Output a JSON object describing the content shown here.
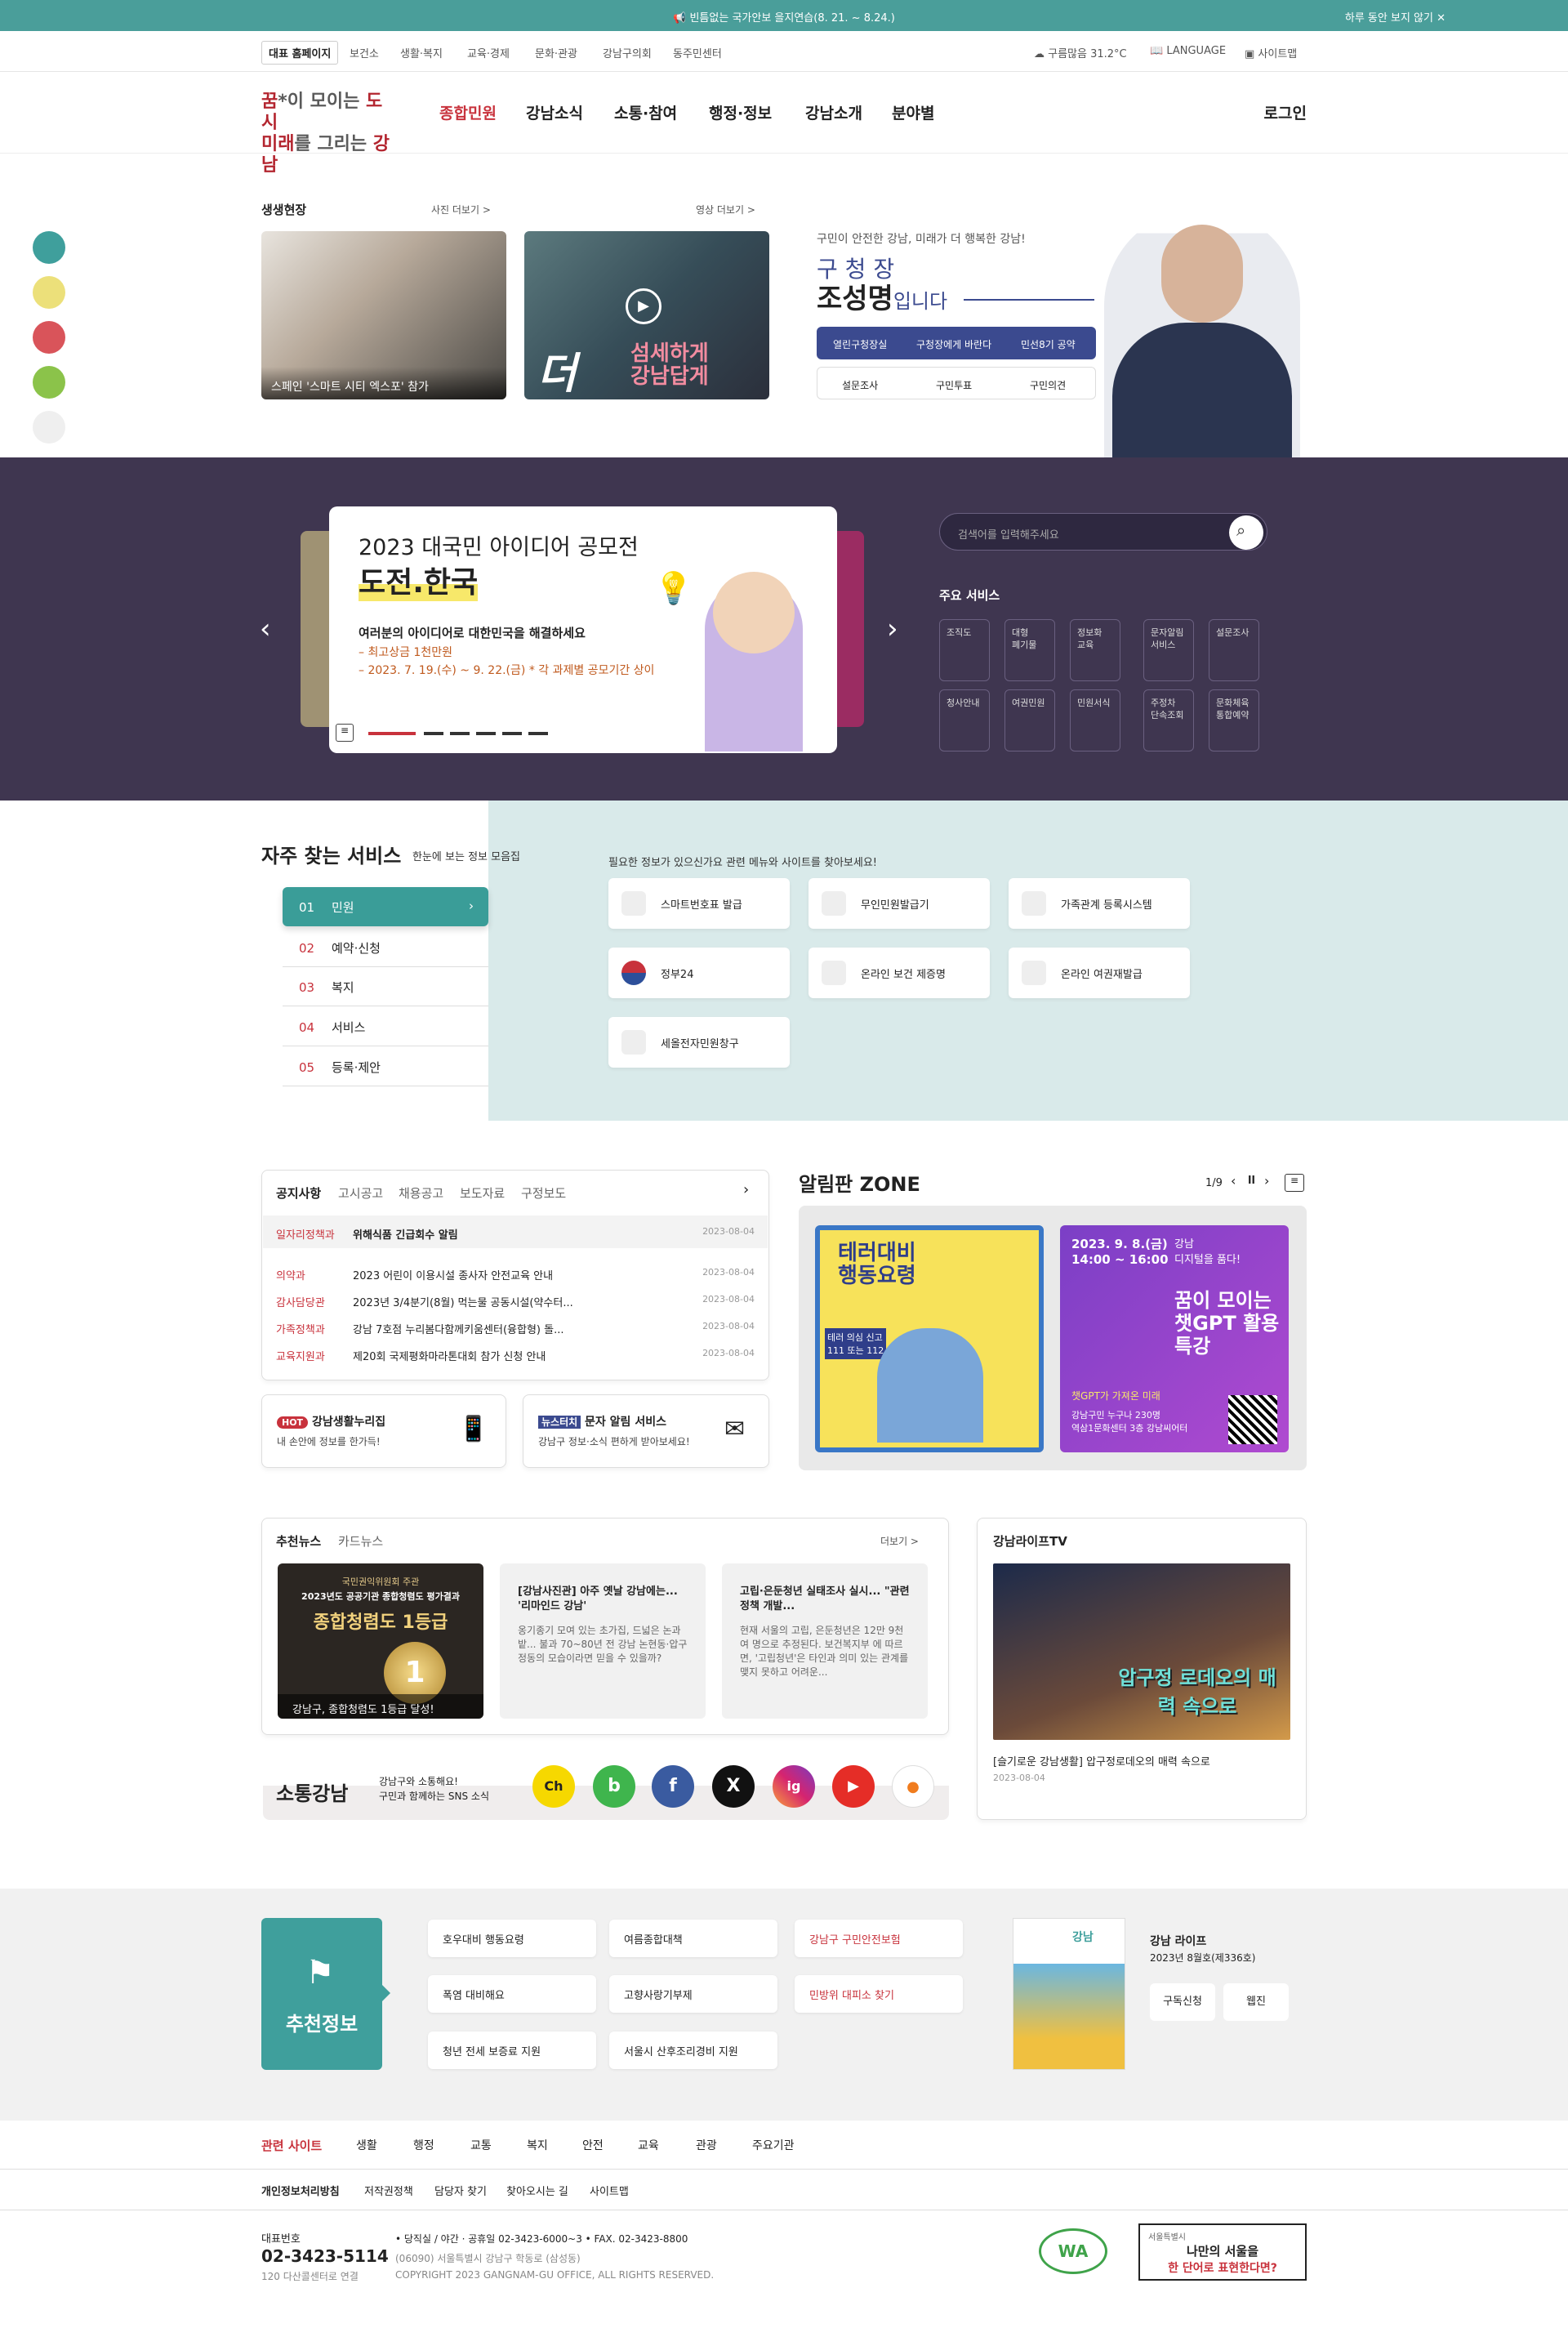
{
  "topbar": {
    "notice": "빈틈없는 국가안보 을지연습(8. 21. ~ 8.24.)",
    "close": "하루 동안 보지 않기"
  },
  "subnav": {
    "home": "대표 홈페이지",
    "links": [
      "보건소",
      "생활·복지",
      "교육·경제",
      "문화·관광",
      "강남구의회",
      "동주민센터"
    ],
    "weather": "구름많음  31.2°C",
    "language": "LANGUAGE",
    "sitemap": "사이트맵"
  },
  "gnb": {
    "logo_line1a": "꿈",
    "logo_line1b": "*이 모이는 ",
    "logo_line1c": "도시",
    "logo_line2a": "미래",
    "logo_line2b": "를 그리는 ",
    "logo_line2c": "강남",
    "menu": [
      "종합민원",
      "강남소식",
      "소통·참여",
      "행정·정보",
      "강남소개",
      "분야별"
    ],
    "login": "로그인"
  },
  "colors": {
    "dots": [
      "#3f9f9c",
      "#ece07a",
      "#d9545a",
      "#8bc34a",
      "#efefef"
    ],
    "accent": "#c8323c",
    "teal": "#3a9d98"
  },
  "live": {
    "title": "생생현장",
    "photo_more": "사진 더보기  >",
    "video_more": "영상 더보기  >",
    "photo_caption": "스페인 '스마트 시티 엑스포' 참가",
    "video_line1": "섬세하게",
    "video_line2": "강남답게",
    "video_big": "더"
  },
  "mayor": {
    "sub": "구민이 안전한 강남, 미래가 더 행복한 강남!",
    "title": "구 청 장",
    "name": "조성명",
    "suffix": "입니다",
    "row1": [
      "열린구청장실",
      "구청장에게 바란다",
      "민선8기 공약"
    ],
    "row2": [
      "설문조사",
      "구민투표",
      "구민의견"
    ]
  },
  "banner": {
    "title1": "2023 대국민 아이디어 공모전",
    "title2": "도전.한국",
    "desc1": "여러분의 아이디어로 대한민국을 해결하세요",
    "desc2": "– 최고상금 1천만원",
    "desc3": "– 2023. 7. 19.(수) ~ 9. 22.(금)  * 각 과제별 공모기간 상이"
  },
  "search": {
    "placeholder": "검색어를 입력해주세요"
  },
  "services": {
    "title": "주요 서비스",
    "items": [
      "조직도",
      "대형\n폐기물",
      "정보화\n교육",
      "문자알림\n서비스",
      "설문조사",
      "청사안내",
      "여권민원",
      "민원서식",
      "주정차\n단속조회",
      "문화체육\n통합예약"
    ]
  },
  "freq": {
    "title": "자주 찾는 서비스",
    "sub": "한눈에 보는 정보 모음집",
    "desc": "필요한 정보가 있으신가요 관련 메뉴와 사이트를 찾아보세요!",
    "tabs": [
      {
        "no": "01",
        "label": "민원"
      },
      {
        "no": "02",
        "label": "예약·신청"
      },
      {
        "no": "03",
        "label": "복지"
      },
      {
        "no": "04",
        "label": "서비스"
      },
      {
        "no": "05",
        "label": "등록·제안"
      }
    ],
    "items": [
      "스마트번호표 발급",
      "무인민원발급기",
      "가족관계 등록시스템",
      "정부24",
      "온라인 보건 제증명",
      "온라인 여권재발급",
      "세올전자민원창구"
    ]
  },
  "notice": {
    "tabs": [
      "공지사항",
      "고시공고",
      "채용공고",
      "보도자료",
      "구정보도"
    ],
    "rows": [
      {
        "cat": "일자리정책과",
        "title": "위해식품 긴급회수 알림",
        "date": "2023-08-04"
      },
      {
        "cat": "의약과",
        "title": "2023 어린이 이용시설 종사자 안전교육 안내",
        "date": "2023-08-04"
      },
      {
        "cat": "감사담당관",
        "title": "2023년 3/4분기(8월) 먹는물 공동시설(약수터...",
        "date": "2023-08-04"
      },
      {
        "cat": "가족정책과",
        "title": "강남 7호점 누리봄다함께키움센터(융합형) 돌...",
        "date": "2023-08-04"
      },
      {
        "cat": "교육지원과",
        "title": "제20회 국제평화마라톤대회 참가 신청 안내",
        "date": "2023-08-04"
      }
    ],
    "hot": "HOT",
    "hot_title": "강남생활누리집",
    "hot_sub": "내 손안에 정보를 한가득!",
    "news_tag": "뉴스터치",
    "news_title": "문자 알림 서비스",
    "news_sub": "강남구 정보·소식 편하게 받아보세요!"
  },
  "alim": {
    "title": "알림판 ZONE",
    "page": "1/9",
    "p1_title": "테러대비\n행동요령",
    "p1_sub": "테러 의심 신고\n111 또는 112",
    "p2_date": "2023. 9. 8.(금)\n14:00 ~ 16:00",
    "p2_tag": "강남\n디지털을 품다!",
    "p2_title": "꿈이 모이는\n챗GPT 활용\n특강",
    "p2_sub": "챗GPT가 가져온 미래",
    "p2_place": "강남구민 누구나 230명\n역삼1문화센터 3층 강남씨어터"
  },
  "recnews": {
    "tabs": [
      "추천뉴스",
      "카드뉴스"
    ],
    "more": "더보기  >",
    "card1_cap": "강남구, 종합청렴도 1등급 달성!",
    "card1_top": "국민권익위원회 주관",
    "card1_mid": "2023년도 공공기관 종합청렴도 평가결과",
    "card1_big": "종합청렴도 1등급",
    "card2_title": "[강남사진관] 아주 옛날 강남에는... '리마인드 강남'",
    "card2_body": "옹기종기 모여 있는 초가집, 드넓은 논과 밭... 불과 70~80년 전 강남 논현동·압구정동의 모습이라면 믿을 수 있을까?",
    "card3_title": "고립·은둔청년 실태조사 실시... \"관련 정책 개발...",
    "card3_body": "현재 서울의 고립, 은둔청년은 12만 9천여 명으로 추정된다. 보건복지부 에 따르면, '고립청년'은 타인과 의미 있는 관계를 맺지 못하고 어려운..."
  },
  "sotong": {
    "title": "소통강남",
    "sub1": "강남구와 소통해요!",
    "sub2": "구민과 함께하는 SNS 소식",
    "icons": [
      "Ch",
      "b",
      "f",
      "X",
      "ig",
      "▶",
      "●"
    ]
  },
  "tv": {
    "title": "강남라이프TV",
    "thumb_text": "압구정 로데오의 매력 속으로",
    "caption": "[슬기로운 강남생활] 압구정로데오의 매력 속으로",
    "date": "2023-08-04"
  },
  "rec": {
    "title": "추천정보",
    "items": [
      "호우대비 행동요령",
      "여름종합대책",
      "강남구 구민안전보험",
      "폭염 대비해요",
      "고향사랑기부제",
      "민방위 대피소 찾기",
      "청년 전세 보증료 지원",
      "서울시 산후조리경비 지원"
    ],
    "mag_title": "강남 라이프",
    "mag_sub": "2023년 8월호(제336호)",
    "mag_btn1": "구독신청",
    "mag_btn2": "웹진",
    "mag_cover": "강남"
  },
  "related": {
    "title": "관련 사이트",
    "items": [
      "생활",
      "행정",
      "교통",
      "복지",
      "안전",
      "교육",
      "관광",
      "주요기관"
    ]
  },
  "policy": [
    "개인정보처리방침",
    "저작권정책",
    "담당자 찾기",
    "찾아오시는 길",
    "사이트맵"
  ],
  "footer": {
    "rep_label": "대표번호",
    "rep_no": "02-3423-5114",
    "rep_sub": "120 다산콜센터로 연결",
    "line1": "• 당직실 / 야간 · 공휴일 02-3423-6000~3    • FAX. 02-3423-8800",
    "line2": "(06090) 서울특별시 강남구 학동로 (삼성동)",
    "copy": "COPYRIGHT 2023 GANGNAM-GU OFFICE, ALL RIGHTS RESERVED.",
    "wa": "WA",
    "seoul_tag": "서울특별시",
    "seoul1": "나만의 서울을",
    "seoul2": "한 단어로 표현한다면?"
  }
}
